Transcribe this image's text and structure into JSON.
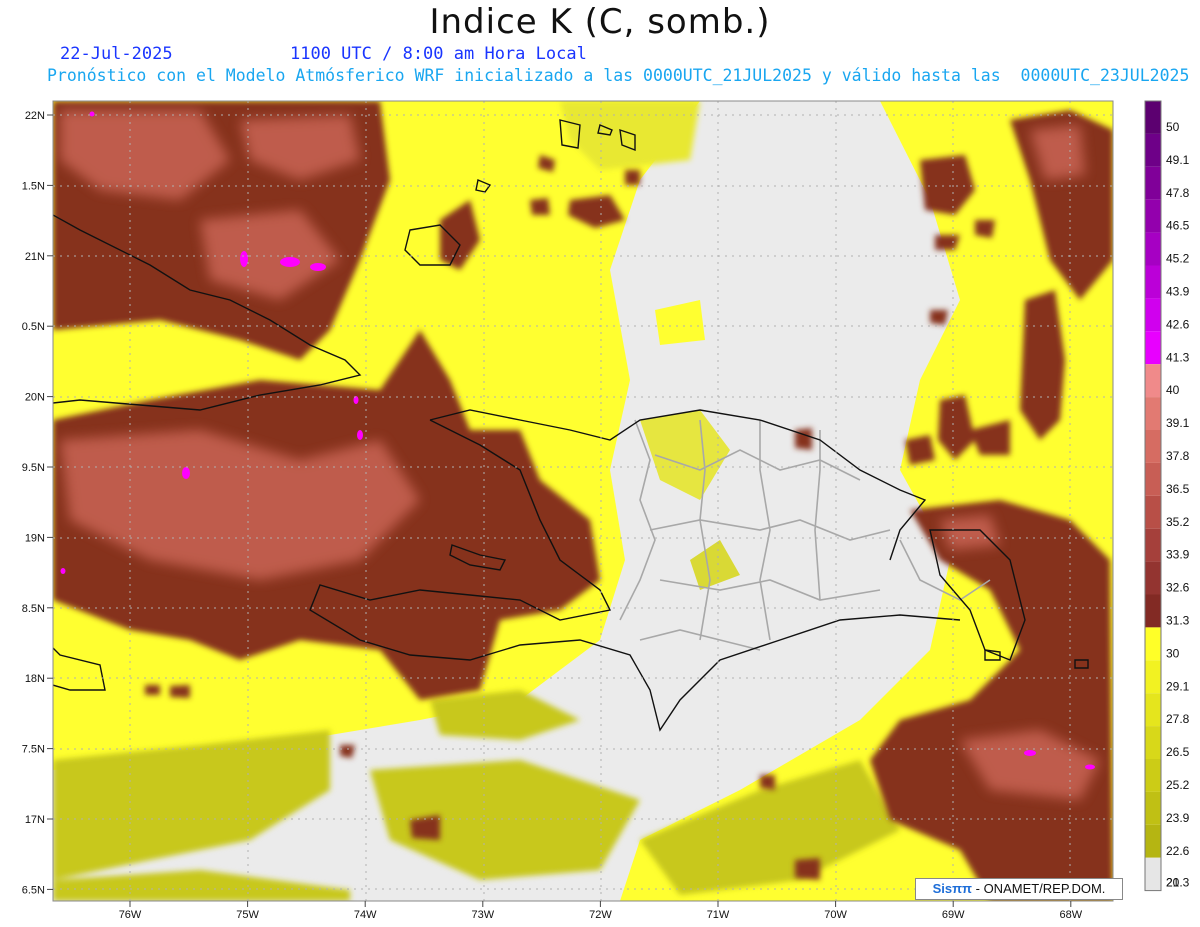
{
  "header": {
    "title": "Indice K (C, somb.)",
    "date": "22-Jul-2025",
    "time": "1100 UTC / 8:00 am Hora Local",
    "description": "Pronóstico con el Modelo Atmósferico WRF inicializado a las 0000UTC_21JUL2025 y válido hasta las  0000UTC_23JUL2025"
  },
  "axes": {
    "lat_labels": [
      "22N",
      "1.5N",
      "21N",
      "0.5N",
      "20N",
      "9.5N",
      "19N",
      "8.5N",
      "18N",
      "7.5N",
      "17N",
      "6.5N"
    ],
    "lon_labels": [
      "76W",
      "75W",
      "74W",
      "73W",
      "72W",
      "71W",
      "70W",
      "69W",
      "68W"
    ]
  },
  "colorbar": {
    "labels": [
      "50",
      "49.1",
      "47.8",
      "46.5",
      "45.2",
      "43.9",
      "42.6",
      "41.3",
      "40",
      "39.1",
      "37.8",
      "36.5",
      "35.2",
      "33.9",
      "32.6",
      "31.3",
      "30",
      "29.1",
      "27.8",
      "26.5",
      "25.2",
      "23.9",
      "22.6",
      "21.3",
      "20"
    ],
    "colors": [
      "#5c0070",
      "#6e0088",
      "#800099",
      "#9300ad",
      "#a600c3",
      "#bb00d8",
      "#d000ee",
      "#e800ff",
      "#f08a8a",
      "#e27a72",
      "#d66c62",
      "#c85e55",
      "#b84f47",
      "#a5403b",
      "#933430",
      "#822a24",
      "#ffff28",
      "#f2f222",
      "#e5e51d",
      "#d8d819",
      "#cccc16",
      "#c0c014",
      "#b5b512",
      "#e6e6e6"
    ]
  },
  "credit": {
    "brand": "Sisππ",
    "text": " - ONAMET/REP.DOM."
  }
}
